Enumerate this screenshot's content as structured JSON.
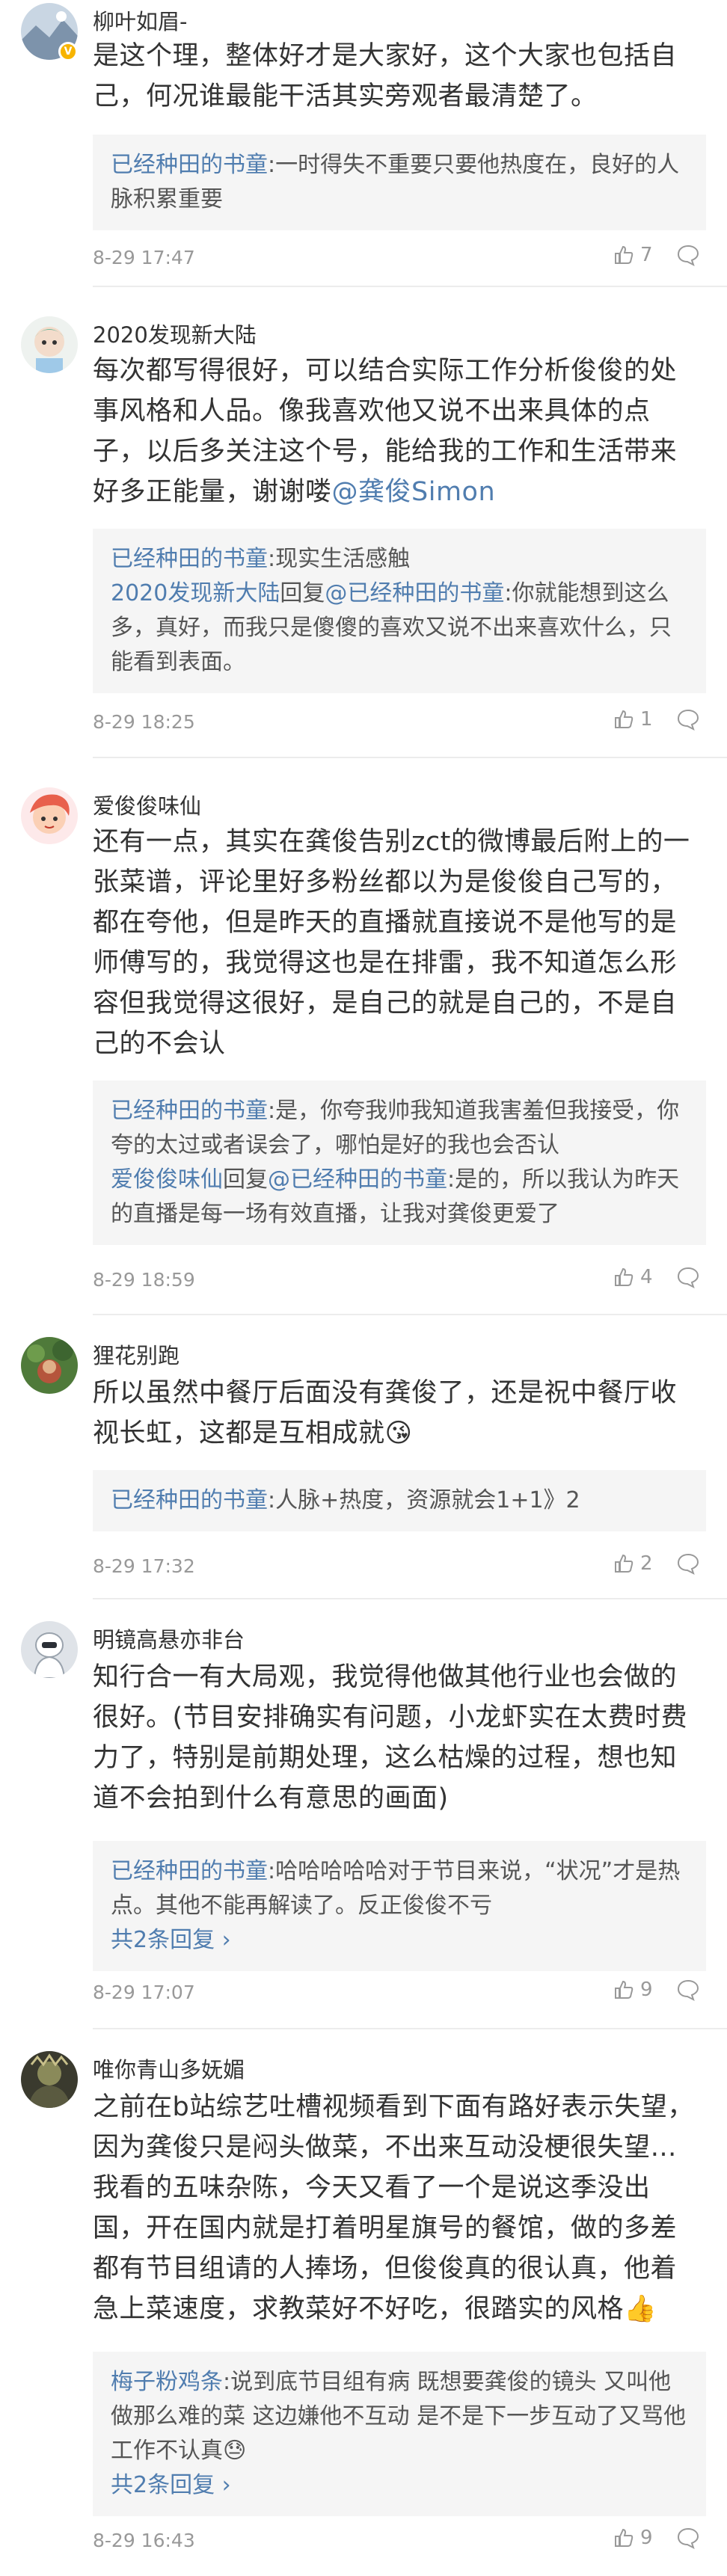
{
  "comments": [
    {
      "user": "柳叶如眉-",
      "verified_badge": "V",
      "text_parts": [
        "是这个理，整体好才是大家好，这个大家也包括自己，何况谁最能干活其实旁观者最清楚了。"
      ],
      "replies": [
        {
          "author": "已经种田的书童",
          "content": ":一时得失不重要只要他热度在，良好的人脉积累重要"
        }
      ],
      "more": "",
      "time": "8-29 17:47",
      "likes": "7"
    },
    {
      "user": "2020发现新大陆",
      "text_before": "每次都写得很好，可以结合实际工作分析俊俊的处事风格和人品。像我喜欢他又说不出来具体的点子，以后多关注这个号，能给我的工作和生活带来好多正能量，谢谢喽",
      "text_mention": "@龚俊Simon",
      "replies": [
        {
          "author": "已经种田的书童",
          "content": ":现实生活感触"
        },
        {
          "author": "2020发现新大陆",
          "mid": "回复",
          "target": "@已经种田的书童",
          "content": ":你就能想到这么多，真好，而我只是傻傻的喜欢又说不出来喜欢什么，只能看到表面。"
        }
      ],
      "time": "8-29 18:25",
      "likes": "1"
    },
    {
      "user": "爱俊俊味仙",
      "text": "还有一点，其实在龚俊告别zct的微博最后附上的一张菜谱，评论里好多粉丝都以为是俊俊自己写的，都在夸他，但是昨天的直播就直接说不是他写的是师傅写的，我觉得这也是在排雷，我不知道怎么形容但我觉得这很好，是自己的就是自己的，不是自己的不会认",
      "replies": [
        {
          "author": "已经种田的书童",
          "content": ":是，你夸我帅我知道我害羞但我接受，你夸的太过或者误会了，哪怕是好的我也会否认"
        },
        {
          "author": "爱俊俊味仙",
          "mid": "回复",
          "target": "@已经种田的书童",
          "content": ":是的，所以我认为昨天的直播是每一场有效直播，让我对龚俊更爱了"
        }
      ],
      "time": "8-29 18:59",
      "likes": "4"
    },
    {
      "user": "狸花别跑",
      "text": "所以虽然中餐厅后面没有龚俊了，还是祝中餐厅收视长虹，这都是互相成就",
      "emoji": "😘",
      "replies": [
        {
          "author": "已经种田的书童",
          "content": ":人脉+热度，资源就会1+1》2"
        }
      ],
      "time": "8-29 17:32",
      "likes": "2"
    },
    {
      "user": "明镜高悬亦非台",
      "text": "知行合一有大局观，我觉得他做其他行业也会做的很好。(节目安排确实有问题，小龙虾实在太费时费力了，特别是前期处理，这么枯燥的过程，想也知道不会拍到什么有意思的画面)",
      "replies": [
        {
          "author": "已经种田的书童",
          "content": ":哈哈哈哈哈对于节目来说，“状况”才是热点。其他不能再解读了。反正俊俊不亏"
        }
      ],
      "more": "共2条回复 ›",
      "time": "8-29 17:07",
      "likes": "9"
    },
    {
      "user": "唯你青山多妩媚",
      "text": "之前在b站综艺吐槽视频看到下面有路好表示失望，因为龚俊只是闷头做菜，不出来互动没梗很失望…我看的五味杂陈，今天又看了一个是说这季没出国，开在国内就是打着明星旗号的餐馆，做的多差都有节目组请的人捧场，但俊俊真的很认真，他着急上菜速度，求教菜好不好吃，很踏实的风格",
      "emoji": "👍",
      "replies": [
        {
          "author": "梅子粉鸡条",
          "content": ":说到底节目组有病 既想要龚俊的镜头 又叫他做那么难的菜 这边嫌他不互动 是不是下一步互动了又骂他工作不认真",
          "emoji": "😓"
        }
      ],
      "more": "共2条回复 ›",
      "time": "8-29 16:43",
      "likes": "9"
    }
  ],
  "icons": {
    "like": "thumbs-up-icon",
    "reply": "comment-bubble-icon"
  },
  "colors": {
    "link": "#507daf",
    "meta": "#999999",
    "reply_bg": "#f5f5f5"
  }
}
